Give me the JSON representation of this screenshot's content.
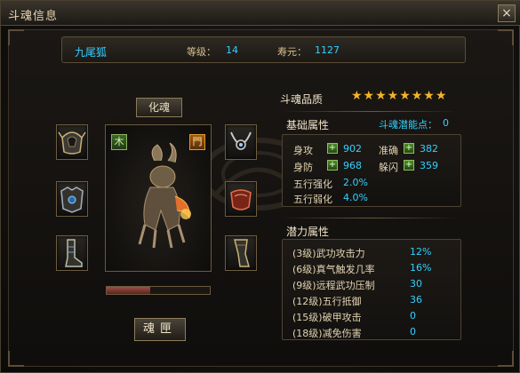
{
  "window": {
    "title": "斗魂信息",
    "close_label": "×"
  },
  "info": {
    "name": "九尾狐",
    "level_label": "等级：",
    "level_value": "14",
    "lifespan_label": "寿元：",
    "lifespan_value": "1127"
  },
  "left": {
    "huahun_button": "化魂",
    "element_badge": "木",
    "sect_badge": "門",
    "soul_box_button": "魂匣",
    "exp_progress": 0.42,
    "slots": [
      {
        "name": "helmet-slot",
        "icon": "helmet-icon"
      },
      {
        "name": "armor-slot",
        "icon": "armor-icon"
      },
      {
        "name": "boots-slot",
        "icon": "boots-icon"
      },
      {
        "name": "necklace-slot",
        "icon": "necklace-icon"
      },
      {
        "name": "bracer-slot",
        "icon": "bracer-icon"
      },
      {
        "name": "leg-armor-slot",
        "icon": "leg-armor-icon"
      }
    ]
  },
  "quality": {
    "label": "斗魂品质",
    "stars": "★★★★★★★★",
    "star_count": 8
  },
  "basic": {
    "title": "基础属性",
    "potential_label": "斗魂潜能点：",
    "potential_value": "0",
    "stats": [
      {
        "label": "身攻",
        "value": "902"
      },
      {
        "label": "准确",
        "value": "382"
      },
      {
        "label": "身防",
        "value": "968"
      },
      {
        "label": "躲闪",
        "value": "359"
      }
    ],
    "wuxing_strengthen_label": "五行强化",
    "wuxing_strengthen_value": "2.0%",
    "wuxing_weaken_label": "五行弱化",
    "wuxing_weaken_value": "4.0%"
  },
  "potential": {
    "title": "潜力属性",
    "rows": [
      {
        "label": "(3级)武功攻击力",
        "value": "12%"
      },
      {
        "label": "(6级)真气触发几率",
        "value": "16%"
      },
      {
        "label": "(9级)远程武功压制",
        "value": "30"
      },
      {
        "label": "(12级)五行抵御",
        "value": "36"
      },
      {
        "label": "(15级)破甲攻击",
        "value": "0"
      },
      {
        "label": "(18级)减免伤害",
        "value": "0"
      }
    ]
  },
  "colors": {
    "accent": "#33d0ff",
    "star": "#f4b428",
    "text": "#e3d4b2"
  }
}
